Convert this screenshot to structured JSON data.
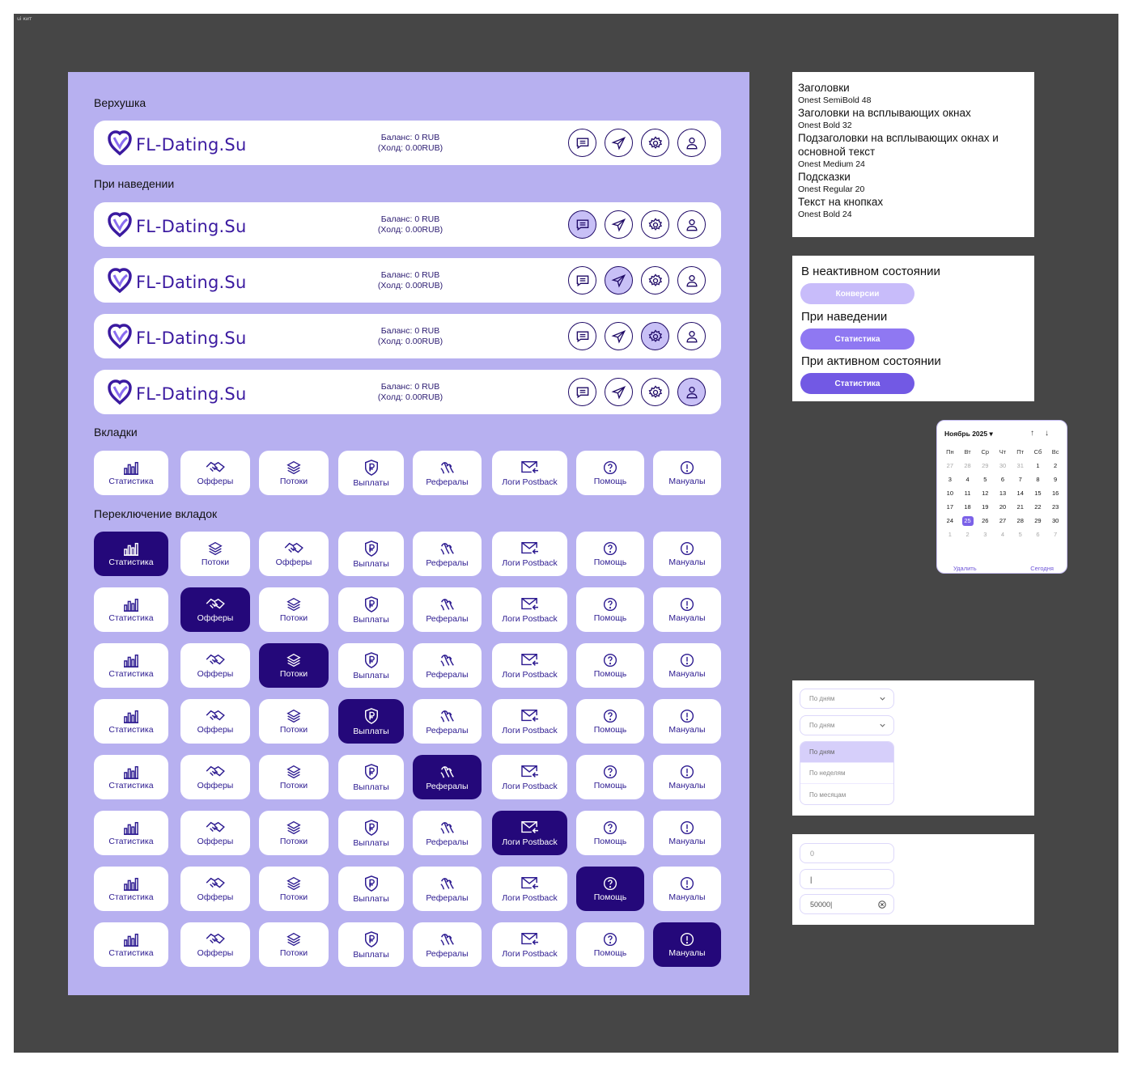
{
  "frame_label": "ui кит",
  "sections": {
    "top": "Верхушка",
    "hover": "При наведении",
    "tabs": "Вкладки",
    "switch": "Переключение вкладок"
  },
  "header": {
    "logo": "FL-Dating.Su",
    "balance": "Баланс: 0 RUB",
    "hold": "(Холд: 0.00RUB)"
  },
  "tabs_a": [
    "Статистика",
    "Офферы",
    "Потоки",
    "Выплаты",
    "Рефералы",
    "Логи Postback",
    "Помощь",
    "Мануалы"
  ],
  "tabs_b": [
    "Статистика",
    "Потоки",
    "Офферы",
    "Выплаты",
    "Рефералы",
    "Логи Postback",
    "Помощь",
    "Мануалы"
  ],
  "typography": {
    "h1": "Заголовки",
    "h1_sub": "Onest SemiBold 48",
    "h2": "Заголовки на всплывающих окнах",
    "h2_sub": "Onest Bold 32",
    "h3a": "Подзаголовки на всплывающих окнах и",
    "h3b": "основной текст",
    "h3_sub": "Onest Medium 24",
    "h4": "Подсказки",
    "h4_sub": "Onest Regular 20",
    "h5": "Текст на кнопках",
    "h5_sub": "Onest Bold 24"
  },
  "states": {
    "inactive_title": "В неактивном состоянии",
    "inactive_btn": "Конверсии",
    "hover_title": "При наведении",
    "hover_btn": "Статистика",
    "active_title": "При активном состоянии",
    "active_btn": "Статистика"
  },
  "colors": {
    "panel": "#b7b0f0",
    "accent_dark": "#24087a",
    "pill_inactive": "#c8bcfa",
    "pill_hover": "#8f78f2",
    "pill_active": "#7259e4"
  },
  "calendar": {
    "month": "Ноябрь 2025",
    "weekdays": [
      "Пн",
      "Вт",
      "Ср",
      "Чт",
      "Пт",
      "Сб",
      "Вс"
    ],
    "days": [
      [
        "27",
        "28",
        "29",
        "30",
        "31",
        "1",
        "2"
      ],
      [
        "3",
        "4",
        "5",
        "6",
        "7",
        "8",
        "9"
      ],
      [
        "10",
        "11",
        "12",
        "13",
        "14",
        "15",
        "16"
      ],
      [
        "17",
        "18",
        "19",
        "20",
        "21",
        "22",
        "23"
      ],
      [
        "24",
        "25",
        "26",
        "27",
        "28",
        "29",
        "30"
      ],
      [
        "1",
        "2",
        "3",
        "4",
        "5",
        "6",
        "7"
      ]
    ],
    "selected": "25",
    "delete": "Удалить",
    "today": "Сегодня"
  },
  "dropdown": {
    "value1": "По дням",
    "value2": "По дням",
    "options": [
      "По дням",
      "По неделям",
      "По месяцам"
    ]
  },
  "inputs": {
    "placeholder": "0",
    "typing": "|",
    "filled": "50000|"
  }
}
